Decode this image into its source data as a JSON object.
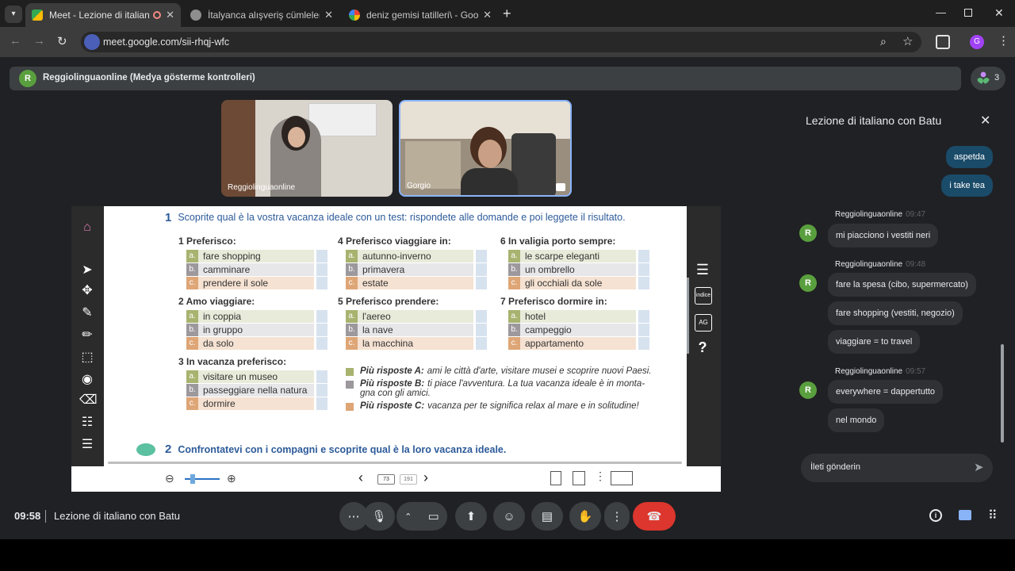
{
  "tabs": [
    {
      "title": "Meet - Lezione di italiano c",
      "active": true
    },
    {
      "title": "İtalyanca alışveriş cümleleri",
      "active": false
    },
    {
      "title": "deniz gemisi tatilleri\\ - Google",
      "active": false
    }
  ],
  "address": {
    "url": "meet.google.com/sii-rhqj-wfc"
  },
  "profile_initial": "G",
  "infobar": {
    "avatar": "R",
    "text": "Reggiolinguaonline (Medya gösterme kontrolleri)",
    "participants": "3"
  },
  "tiles": [
    {
      "name": "Reggiolinguaonline"
    },
    {
      "name": "Gorgio"
    }
  ],
  "doc": {
    "ex1": {
      "num": "1",
      "title": "Scoprite qual è la vostra vacanza ideale con un test: rispondete alle domande e poi leggete il risultato."
    },
    "questions": [
      {
        "num": "1",
        "title": "Preferisco:",
        "options": [
          {
            "l": "a.",
            "t": "fare shopping"
          },
          {
            "l": "b.",
            "t": "camminare"
          },
          {
            "l": "c.",
            "t": "prendere il sole"
          }
        ]
      },
      {
        "num": "2",
        "title": "Amo viaggiare:",
        "options": [
          {
            "l": "a.",
            "t": "in coppia"
          },
          {
            "l": "b.",
            "t": "in gruppo"
          },
          {
            "l": "c.",
            "t": "da solo"
          }
        ]
      },
      {
        "num": "3",
        "title": "In vacanza preferisco:",
        "options": [
          {
            "l": "a.",
            "t": "visitare un museo"
          },
          {
            "l": "b.",
            "t": "passeggiare nella natura"
          },
          {
            "l": "c.",
            "t": "dormire"
          }
        ]
      },
      {
        "num": "4",
        "title": "Preferisco viaggiare in:",
        "options": [
          {
            "l": "a.",
            "t": "autunno-inverno"
          },
          {
            "l": "b.",
            "t": "primavera"
          },
          {
            "l": "c.",
            "t": "estate"
          }
        ]
      },
      {
        "num": "5",
        "title": "Preferisco prendere:",
        "options": [
          {
            "l": "a.",
            "t": "l'aereo"
          },
          {
            "l": "b.",
            "t": "la nave"
          },
          {
            "l": "c.",
            "t": "la macchina"
          }
        ]
      },
      {
        "num": "6",
        "title": "In valigia porto sempre:",
        "options": [
          {
            "l": "a.",
            "t": "le scarpe eleganti"
          },
          {
            "l": "b.",
            "t": "un ombrello"
          },
          {
            "l": "c.",
            "t": "gli occhiali da sole"
          }
        ]
      },
      {
        "num": "7",
        "title": "Preferisco dormire in:",
        "options": [
          {
            "l": "a.",
            "t": "hotel"
          },
          {
            "l": "b.",
            "t": "campeggio"
          },
          {
            "l": "c.",
            "t": "appartamento"
          }
        ]
      }
    ],
    "results": [
      {
        "k": "Più risposte A:",
        "t": "ami le città d'arte, visitare musei e scoprire nuovi Paesi."
      },
      {
        "k": "Più risposte B:",
        "t": "ti piace l'avventura. La tua vacanza ideale è in monta-gna con gli amici."
      },
      {
        "k": "Più risposte C:",
        "t": "vacanza per te significa relax al mare e in solitudine!"
      }
    ],
    "ex2": {
      "num": "2",
      "title": "Confrontatevi con i compagni e scoprite qual è la loro vacanza ideale."
    },
    "page_current": "73",
    "page_total": "191",
    "side_label_index": "indice",
    "side_label_ag": "AG"
  },
  "chat": {
    "title": "Lezione di italiano con Batu",
    "outgoing": [
      "aspetda",
      "i take tea"
    ],
    "groups": [
      {
        "sender": "Reggiolinguaonline",
        "time": "09:47",
        "messages": [
          "mi piacciono i vestiti neri"
        ]
      },
      {
        "sender": "Reggiolinguaonline",
        "time": "09:48",
        "messages": [
          "fare la spesa (cibo, supermercato)",
          "fare shopping (vestiti, negozio)",
          "viaggiare = to travel"
        ]
      },
      {
        "sender": "Reggiolinguaonline",
        "time": "09:57",
        "messages": [
          "everywhere = dappertutto",
          "nel mondo"
        ]
      }
    ],
    "avatar": "R",
    "input_placeholder": "İleti gönderin"
  },
  "bottom": {
    "time": "09:58",
    "meeting_title": "Lezione di italiano con Batu"
  },
  "colors": {
    "accent_blue": "#1a4b69",
    "end_call_red": "#dc362e",
    "exercise_blue": "#2d5b9a"
  }
}
